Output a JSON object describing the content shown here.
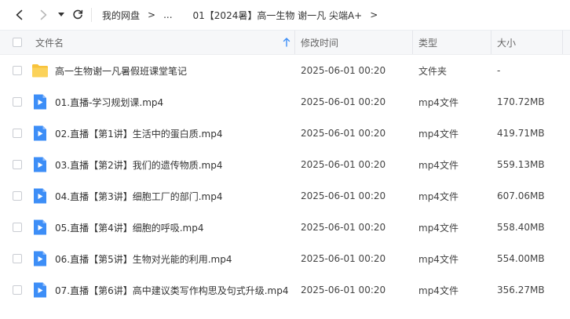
{
  "breadcrumb": {
    "root": "我的网盘",
    "ellipsis": "...",
    "current": "01【2024暑】高一生物 谢一凡 尖端A+"
  },
  "columns": {
    "name": "文件名",
    "time": "修改时间",
    "type": "类型",
    "size": "大小"
  },
  "rows": [
    {
      "kind": "folder",
      "name": "高一生物谢一凡暑假班课堂笔记",
      "time": "2025-06-01 00:20",
      "type": "文件夹",
      "size": "-"
    },
    {
      "kind": "video",
      "name": "01.直播-学习规划课.mp4",
      "time": "2025-06-01 00:20",
      "type": "mp4文件",
      "size": "170.72MB"
    },
    {
      "kind": "video",
      "name": "02.直播【第1讲】生活中的蛋白质.mp4",
      "time": "2025-06-01 00:20",
      "type": "mp4文件",
      "size": "419.71MB"
    },
    {
      "kind": "video",
      "name": "03.直播【第2讲】我们的遗传物质.mp4",
      "time": "2025-06-01 00:20",
      "type": "mp4文件",
      "size": "559.13MB"
    },
    {
      "kind": "video",
      "name": "04.直播【第3讲】细胞工厂的部门.mp4",
      "time": "2025-06-01 00:20",
      "type": "mp4文件",
      "size": "607.06MB"
    },
    {
      "kind": "video",
      "name": "05.直播【第4讲】细胞的呼吸.mp4",
      "time": "2025-06-01 00:20",
      "type": "mp4文件",
      "size": "558.40MB"
    },
    {
      "kind": "video",
      "name": "06.直播【第5讲】生物对光能的利用.mp4",
      "time": "2025-06-01 00:20",
      "type": "mp4文件",
      "size": "554.00MB"
    },
    {
      "kind": "video",
      "name": "07.直播【第6讲】高中建议类写作构思及句式升级.mp4",
      "time": "2025-06-01 00:20",
      "type": "mp4文件",
      "size": "356.27MB"
    }
  ],
  "colors": {
    "folder": "#f8c33c",
    "video": "#3d8ef7",
    "sort_arrow": "#3d8ef7"
  }
}
